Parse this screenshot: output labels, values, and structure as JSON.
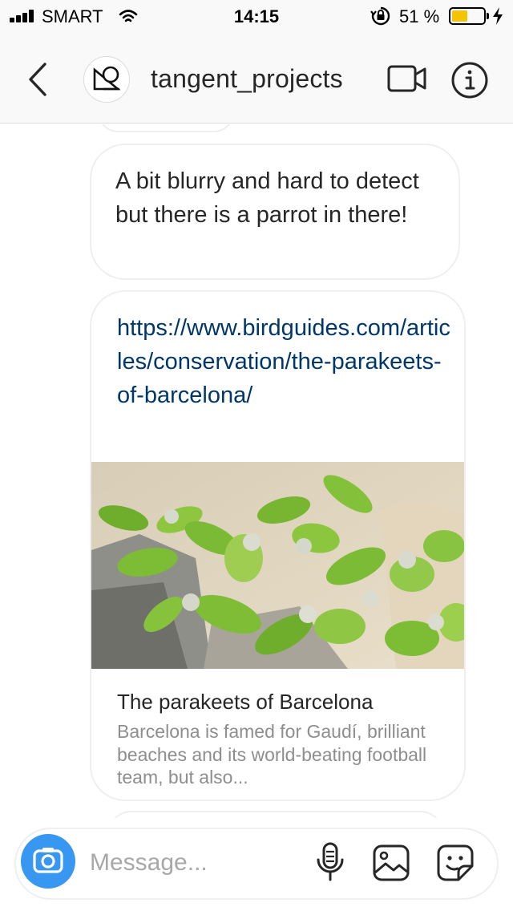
{
  "status_bar": {
    "carrier": "SMART",
    "time": "14:15",
    "battery_percent_label": "51 %",
    "battery_level": 0.51,
    "battery_color": "#f5c400",
    "icons": [
      "signal-bars-icon",
      "wifi-icon",
      "orientation-lock-icon",
      "battery-icon",
      "charging-bolt-icon"
    ]
  },
  "header": {
    "username": "tangent_projects",
    "icons": [
      "back-chevron-icon",
      "avatar-logo-icon",
      "video-camera-icon",
      "info-icon"
    ]
  },
  "messages": [
    {
      "type": "text",
      "text": "A bit blurry and hard to detect but there is a parrot in there!"
    },
    {
      "type": "link",
      "url": "https://www.birdguides.com/articles/conservation/the-parakeets-of-barcelona/",
      "title": "The parakeets of Barcelona",
      "description": "Barcelona is famed for Gaudí, brilliant beaches and its world-beating football team, but also..."
    }
  ],
  "composer": {
    "placeholder": "Message...",
    "accent_color": "#3897f0",
    "icons": [
      "camera-icon",
      "microphone-icon",
      "gallery-icon",
      "sticker-icon"
    ]
  },
  "colors": {
    "link": "#00376b",
    "secondary_text": "#8e8e8e",
    "bubble_border": "#efefef"
  }
}
